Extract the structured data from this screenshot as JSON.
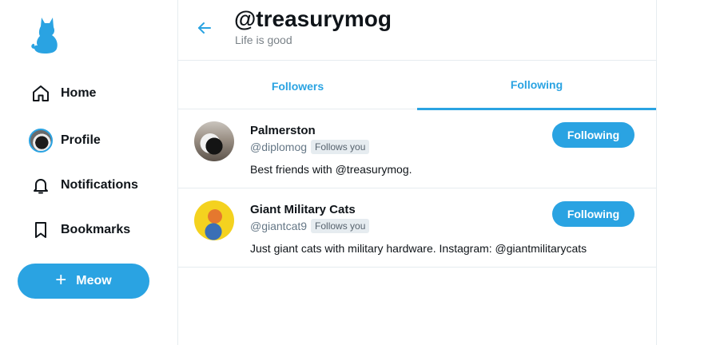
{
  "app": {
    "colors": {
      "accent": "#2aa3e2",
      "text": "#0f1419",
      "muted": "#657786",
      "border": "#e6ecf0"
    }
  },
  "sidebar": {
    "logo_icon": "cat-logo-icon",
    "nav": [
      {
        "label": "Home",
        "icon": "home-icon"
      },
      {
        "label": "Profile",
        "icon": "avatar"
      },
      {
        "label": "Notifications",
        "icon": "bell-icon"
      },
      {
        "label": "Bookmarks",
        "icon": "bookmark-icon"
      }
    ],
    "compose": {
      "label": "Meow",
      "icon": "plus-icon"
    }
  },
  "header": {
    "back_icon": "arrow-left-icon",
    "handle": "@treasurymog",
    "bio": "Life is good"
  },
  "tabs": [
    {
      "label": "Followers",
      "active": false
    },
    {
      "label": "Following",
      "active": true
    }
  ],
  "users": [
    {
      "name": "Palmerston",
      "handle": "@diplomog",
      "badge": "Follows you",
      "description": "Best friends with @treasurymog.",
      "button": "Following"
    },
    {
      "name": "Giant Military Cats",
      "handle": "@giantcat9",
      "badge": "Follows you",
      "description": "Just giant cats with military hardware. Instagram: @giantmilitarycats",
      "button": "Following"
    }
  ]
}
